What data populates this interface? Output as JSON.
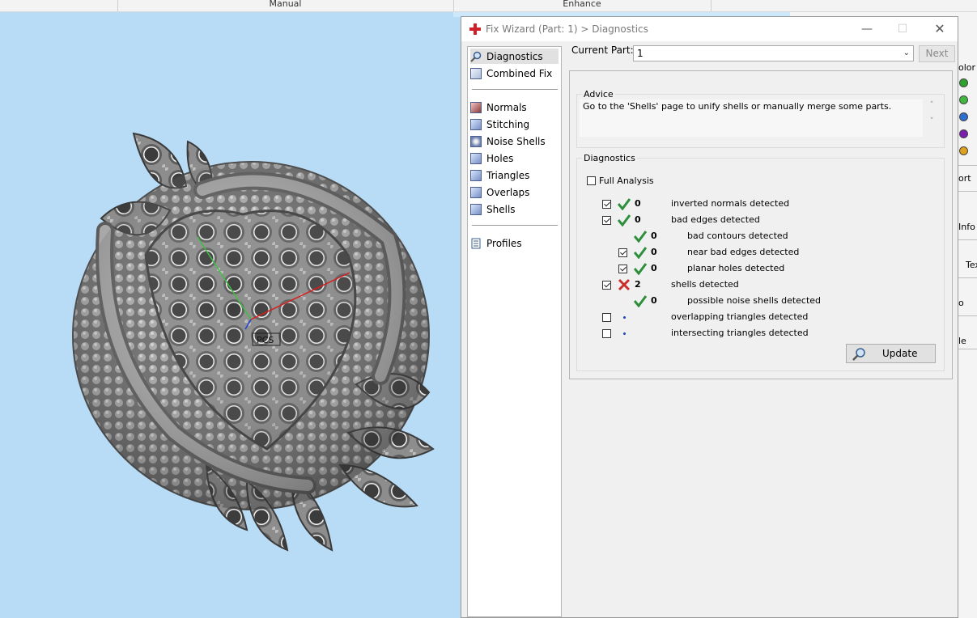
{
  "ribbon": {
    "groups": [
      "Manual",
      "Enhance"
    ]
  },
  "viewport": {
    "axis_label": "PCS",
    "background": "#b9dcf6"
  },
  "dialog": {
    "title": "Fix Wizard (Part: 1) > Diagnostics",
    "nav": {
      "top": [
        {
          "label": "Diagnostics",
          "icon": "magnifier-icon",
          "selected": true
        },
        {
          "label": "Combined Fix",
          "icon": "combined-fix-icon"
        }
      ],
      "pages": [
        {
          "label": "Normals",
          "icon": "normals-icon"
        },
        {
          "label": "Stitching",
          "icon": "stitching-icon"
        },
        {
          "label": "Noise Shells",
          "icon": "noise-shells-icon"
        },
        {
          "label": "Holes",
          "icon": "holes-icon"
        },
        {
          "label": "Triangles",
          "icon": "triangles-icon"
        },
        {
          "label": "Overlaps",
          "icon": "overlaps-icon"
        },
        {
          "label": "Shells",
          "icon": "shells-icon"
        }
      ],
      "bottom": [
        {
          "label": "Profiles",
          "icon": "profiles-icon"
        }
      ]
    },
    "current_part_label": "Current Part:",
    "current_part_value": "1",
    "next_label": "Next",
    "advice": {
      "title": "Advice",
      "text": "Go to the 'Shells' page to unify shells or manually merge some parts."
    },
    "diagnostics": {
      "title": "Diagnostics",
      "full_analysis_label": "Full Analysis",
      "full_analysis_checked": false,
      "rows": [
        {
          "checkbox": true,
          "checked": true,
          "status": "ok",
          "count": "0",
          "label": "inverted normals detected",
          "indent": 0
        },
        {
          "checkbox": true,
          "checked": true,
          "status": "ok",
          "count": "0",
          "label": "bad edges detected",
          "indent": 0
        },
        {
          "checkbox": false,
          "checked": false,
          "status": "ok",
          "count": "0",
          "label": "bad contours detected",
          "indent": 1
        },
        {
          "checkbox": true,
          "checked": true,
          "status": "ok",
          "count": "0",
          "label": "near bad edges detected",
          "indent": 1
        },
        {
          "checkbox": true,
          "checked": true,
          "status": "ok",
          "count": "0",
          "label": "planar holes detected",
          "indent": 1
        },
        {
          "checkbox": true,
          "checked": true,
          "status": "fail",
          "count": "2",
          "label": "shells detected",
          "indent": 0
        },
        {
          "checkbox": false,
          "checked": false,
          "status": "ok",
          "count": "0",
          "label": "possible noise shells detected",
          "indent": 1
        },
        {
          "checkbox": true,
          "checked": false,
          "status": "none",
          "count": "",
          "label": "overlapping triangles detected",
          "indent": 0
        },
        {
          "checkbox": true,
          "checked": false,
          "status": "none",
          "count": "",
          "label": "intersecting triangles detected",
          "indent": 0
        }
      ],
      "update_label": "Update"
    }
  },
  "right_panel": {
    "items": [
      "olor",
      "ort",
      "Info",
      "Tex",
      "o",
      "le"
    ],
    "dot_colors": [
      "#2ea12e",
      "#3fb83f",
      "#2e6fd0",
      "#7b1fb0",
      "#e0a020"
    ]
  },
  "colors": {
    "ok": "#2c8f3c",
    "fail": "#c9302c",
    "accent": "#1a45b8"
  }
}
